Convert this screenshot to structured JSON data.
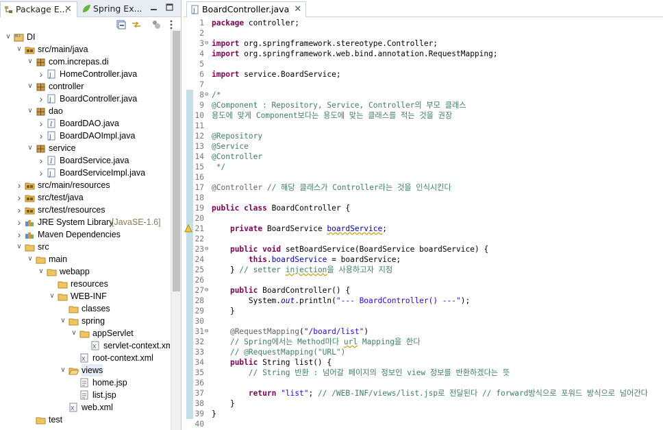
{
  "left_tabs": [
    {
      "label": "Package E...",
      "active": true
    },
    {
      "label": "Spring Ex...",
      "active": false
    }
  ],
  "editor_tab": {
    "label": "BoardController.java"
  },
  "tree": [
    {
      "label": "DI",
      "depth": 0,
      "arrow": "open",
      "icon": "project-icon"
    },
    {
      "label": "src/main/java",
      "depth": 1,
      "arrow": "open",
      "icon": "source-folder-icon"
    },
    {
      "label": "com.increpas.di",
      "depth": 2,
      "arrow": "open",
      "icon": "package-icon"
    },
    {
      "label": "HomeController.java",
      "depth": 3,
      "arrow": "closed",
      "icon": "java-file-icon"
    },
    {
      "label": "controller",
      "depth": 2,
      "arrow": "open",
      "icon": "package-icon"
    },
    {
      "label": "BoardController.java",
      "depth": 3,
      "arrow": "closed",
      "icon": "java-file-icon"
    },
    {
      "label": "dao",
      "depth": 2,
      "arrow": "open",
      "icon": "package-icon"
    },
    {
      "label": "BoardDAO.java",
      "depth": 3,
      "arrow": "closed",
      "icon": "java-interface-icon"
    },
    {
      "label": "BoardDAOImpl.java",
      "depth": 3,
      "arrow": "closed",
      "icon": "java-file-icon"
    },
    {
      "label": "service",
      "depth": 2,
      "arrow": "open",
      "icon": "package-icon"
    },
    {
      "label": "BoardService.java",
      "depth": 3,
      "arrow": "closed",
      "icon": "java-interface-icon"
    },
    {
      "label": "BoardServiceImpl.java",
      "depth": 3,
      "arrow": "closed",
      "icon": "java-file-icon"
    },
    {
      "label": "src/main/resources",
      "depth": 1,
      "arrow": "closed",
      "icon": "source-folder-icon"
    },
    {
      "label": "src/test/java",
      "depth": 1,
      "arrow": "closed",
      "icon": "source-folder-icon"
    },
    {
      "label": "src/test/resources",
      "depth": 1,
      "arrow": "closed",
      "icon": "source-folder-icon"
    },
    {
      "label": "JRE System Library",
      "decoration": "[JavaSE-1.6]",
      "depth": 1,
      "arrow": "closed",
      "icon": "library-icon"
    },
    {
      "label": "Maven Dependencies",
      "depth": 1,
      "arrow": "closed",
      "icon": "library-icon"
    },
    {
      "label": "src",
      "depth": 1,
      "arrow": "open",
      "icon": "folder-icon"
    },
    {
      "label": "main",
      "depth": 2,
      "arrow": "open",
      "icon": "folder-icon"
    },
    {
      "label": "webapp",
      "depth": 3,
      "arrow": "open",
      "icon": "folder-icon"
    },
    {
      "label": "resources",
      "depth": 4,
      "arrow": "none",
      "icon": "folder-icon"
    },
    {
      "label": "WEB-INF",
      "depth": 4,
      "arrow": "open",
      "icon": "folder-icon"
    },
    {
      "label": "classes",
      "depth": 5,
      "arrow": "none",
      "icon": "folder-icon"
    },
    {
      "label": "spring",
      "depth": 5,
      "arrow": "open",
      "icon": "folder-icon"
    },
    {
      "label": "appServlet",
      "depth": 6,
      "arrow": "open",
      "icon": "folder-icon"
    },
    {
      "label": "servlet-context.xml",
      "depth": 7,
      "arrow": "none",
      "icon": "xml-file-icon"
    },
    {
      "label": "root-context.xml",
      "depth": 6,
      "arrow": "none",
      "icon": "xml-file-icon"
    },
    {
      "label": "views",
      "depth": 5,
      "arrow": "open",
      "icon": "open-folder-icon",
      "selected": true
    },
    {
      "label": "home.jsp",
      "depth": 6,
      "arrow": "none",
      "icon": "jsp-file-icon"
    },
    {
      "label": "list.jsp",
      "depth": 6,
      "arrow": "none",
      "icon": "jsp-file-icon"
    },
    {
      "label": "web.xml",
      "depth": 5,
      "arrow": "none",
      "icon": "xml-file-icon"
    },
    {
      "label": "test",
      "depth": 2,
      "arrow": "none",
      "icon": "folder-icon"
    }
  ],
  "code": [
    {
      "n": "1",
      "segs": [
        {
          "c": "kw",
          "t": "package"
        },
        {
          "t": " controller;"
        }
      ]
    },
    {
      "n": "2",
      "segs": []
    },
    {
      "n": "3",
      "fold": true,
      "segs": [
        {
          "c": "kw",
          "t": "import"
        },
        {
          "t": " org.springframework.stereotype.Controller;"
        }
      ]
    },
    {
      "n": "4",
      "segs": [
        {
          "c": "kw",
          "t": "import"
        },
        {
          "t": " org.springframework.web.bind.annotation.RequestMapping;"
        }
      ]
    },
    {
      "n": "5",
      "segs": []
    },
    {
      "n": "6",
      "segs": [
        {
          "c": "kw",
          "t": "import"
        },
        {
          "t": " service.BoardService;"
        }
      ]
    },
    {
      "n": "7",
      "segs": []
    },
    {
      "n": "8",
      "fold": true,
      "segs": [
        {
          "c": "cm",
          "t": "/*"
        }
      ]
    },
    {
      "n": "9",
      "segs": [
        {
          "c": "cm",
          "t": "@Component : Repository, Service, Controller의 부모 클래스"
        }
      ]
    },
    {
      "n": "10",
      "segs": [
        {
          "c": "cm",
          "t": "용도에 맞게 Component보다는 용도에 맞는 클래스를 적는 것을 권장"
        }
      ]
    },
    {
      "n": "11",
      "segs": []
    },
    {
      "n": "12",
      "segs": [
        {
          "c": "cm",
          "t": "@Repository"
        }
      ]
    },
    {
      "n": "13",
      "segs": [
        {
          "c": "cm",
          "t": "@Service"
        }
      ]
    },
    {
      "n": "14",
      "segs": [
        {
          "c": "cm",
          "t": "@Controller"
        }
      ]
    },
    {
      "n": "15",
      "segs": [
        {
          "c": "cm",
          "t": " */"
        }
      ]
    },
    {
      "n": "16",
      "segs": []
    },
    {
      "n": "17",
      "segs": [
        {
          "c": "an",
          "t": "@Controller"
        },
        {
          "t": " "
        },
        {
          "c": "cm",
          "t": "// 해당 클래스가 Controller라는 것을 인식시킨다"
        }
      ]
    },
    {
      "n": "18",
      "segs": []
    },
    {
      "n": "19",
      "segs": [
        {
          "c": "kw",
          "t": "public"
        },
        {
          "t": " "
        },
        {
          "c": "kw",
          "t": "class"
        },
        {
          "t": " BoardController {"
        }
      ]
    },
    {
      "n": "20",
      "segs": []
    },
    {
      "n": "21",
      "warn": true,
      "segs": [
        {
          "t": "    "
        },
        {
          "c": "kw",
          "t": "private"
        },
        {
          "t": " BoardService "
        },
        {
          "c": "fd sq",
          "t": "boardService"
        },
        {
          "t": ";"
        }
      ]
    },
    {
      "n": "22",
      "segs": []
    },
    {
      "n": "23",
      "fold": true,
      "segs": [
        {
          "t": "    "
        },
        {
          "c": "kw",
          "t": "public"
        },
        {
          "t": " "
        },
        {
          "c": "kw",
          "t": "void"
        },
        {
          "t": " setBoardService(BoardService boardService) {"
        }
      ]
    },
    {
      "n": "24",
      "segs": [
        {
          "t": "        "
        },
        {
          "c": "kw",
          "t": "this"
        },
        {
          "t": "."
        },
        {
          "c": "fd",
          "t": "boardService"
        },
        {
          "t": " = boardService;"
        }
      ]
    },
    {
      "n": "25",
      "segs": [
        {
          "t": "    } "
        },
        {
          "c": "cm",
          "t": "// setter "
        },
        {
          "c": "cm sq",
          "t": "injection"
        },
        {
          "c": "cm",
          "t": "을 사용하고자 지정"
        }
      ]
    },
    {
      "n": "26",
      "segs": []
    },
    {
      "n": "27",
      "fold": true,
      "segs": [
        {
          "t": "    "
        },
        {
          "c": "kw",
          "t": "public"
        },
        {
          "t": " BoardController() {"
        }
      ]
    },
    {
      "n": "28",
      "segs": [
        {
          "t": "        System."
        },
        {
          "c": "fd it",
          "t": "out"
        },
        {
          "t": ".println("
        },
        {
          "c": "st",
          "t": "\"--- BoardController() ---\""
        },
        {
          "t": ");"
        }
      ]
    },
    {
      "n": "29",
      "segs": [
        {
          "t": "    }"
        }
      ]
    },
    {
      "n": "30",
      "segs": []
    },
    {
      "n": "31",
      "fold": true,
      "segs": [
        {
          "t": "    "
        },
        {
          "c": "an",
          "t": "@RequestMapping"
        },
        {
          "t": "("
        },
        {
          "c": "st",
          "t": "\"/board/list\""
        },
        {
          "t": ")"
        }
      ]
    },
    {
      "n": "32",
      "segs": [
        {
          "t": "    "
        },
        {
          "c": "cm",
          "t": "// Spring에서는 Method마다 "
        },
        {
          "c": "cm sq",
          "t": "url"
        },
        {
          "c": "cm",
          "t": " Mapping을 한다"
        }
      ]
    },
    {
      "n": "33",
      "segs": [
        {
          "t": "    "
        },
        {
          "c": "cm",
          "t": "// @RequestMapping(\"URL\")"
        }
      ]
    },
    {
      "n": "34",
      "segs": [
        {
          "t": "    "
        },
        {
          "c": "kw",
          "t": "public"
        },
        {
          "t": " String list() {"
        }
      ]
    },
    {
      "n": "35",
      "segs": [
        {
          "t": "        "
        },
        {
          "c": "cm",
          "t": "// String 반환 : 넘어갈 페이지의 정보인 view 정보를 반환하겠다는 뜻"
        }
      ]
    },
    {
      "n": "36",
      "segs": []
    },
    {
      "n": "37",
      "segs": [
        {
          "t": "        "
        },
        {
          "c": "kw",
          "t": "return"
        },
        {
          "t": " "
        },
        {
          "c": "st",
          "t": "\"list\""
        },
        {
          "t": "; "
        },
        {
          "c": "cm",
          "t": "// /WEB-INF/views/list.jsp로 전달된다 // forward방식으로 포워드 방식으로 넘어간다"
        }
      ]
    },
    {
      "n": "38",
      "segs": [
        {
          "t": "    }"
        }
      ]
    },
    {
      "n": "39",
      "segs": [
        {
          "t": "}"
        }
      ]
    },
    {
      "n": "40",
      "segs": []
    }
  ],
  "colors": {
    "keyword": "#7f0055",
    "comment": "#3f7f5f",
    "string": "#2a00ff",
    "field": "#0000c0",
    "annotation": "#646464",
    "selection": "#e5ecf7"
  }
}
